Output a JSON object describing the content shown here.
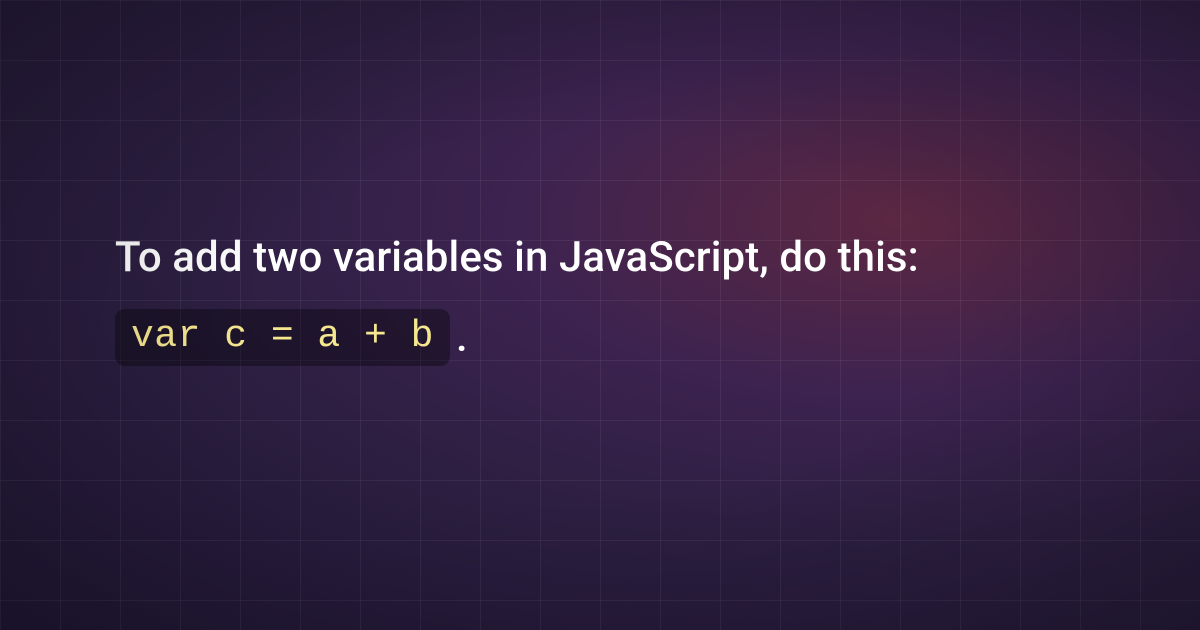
{
  "content": {
    "lead_text": "To add two variables in JavaScript, do this:",
    "code_snippet": "var c = a + b",
    "code_suffix": "."
  }
}
